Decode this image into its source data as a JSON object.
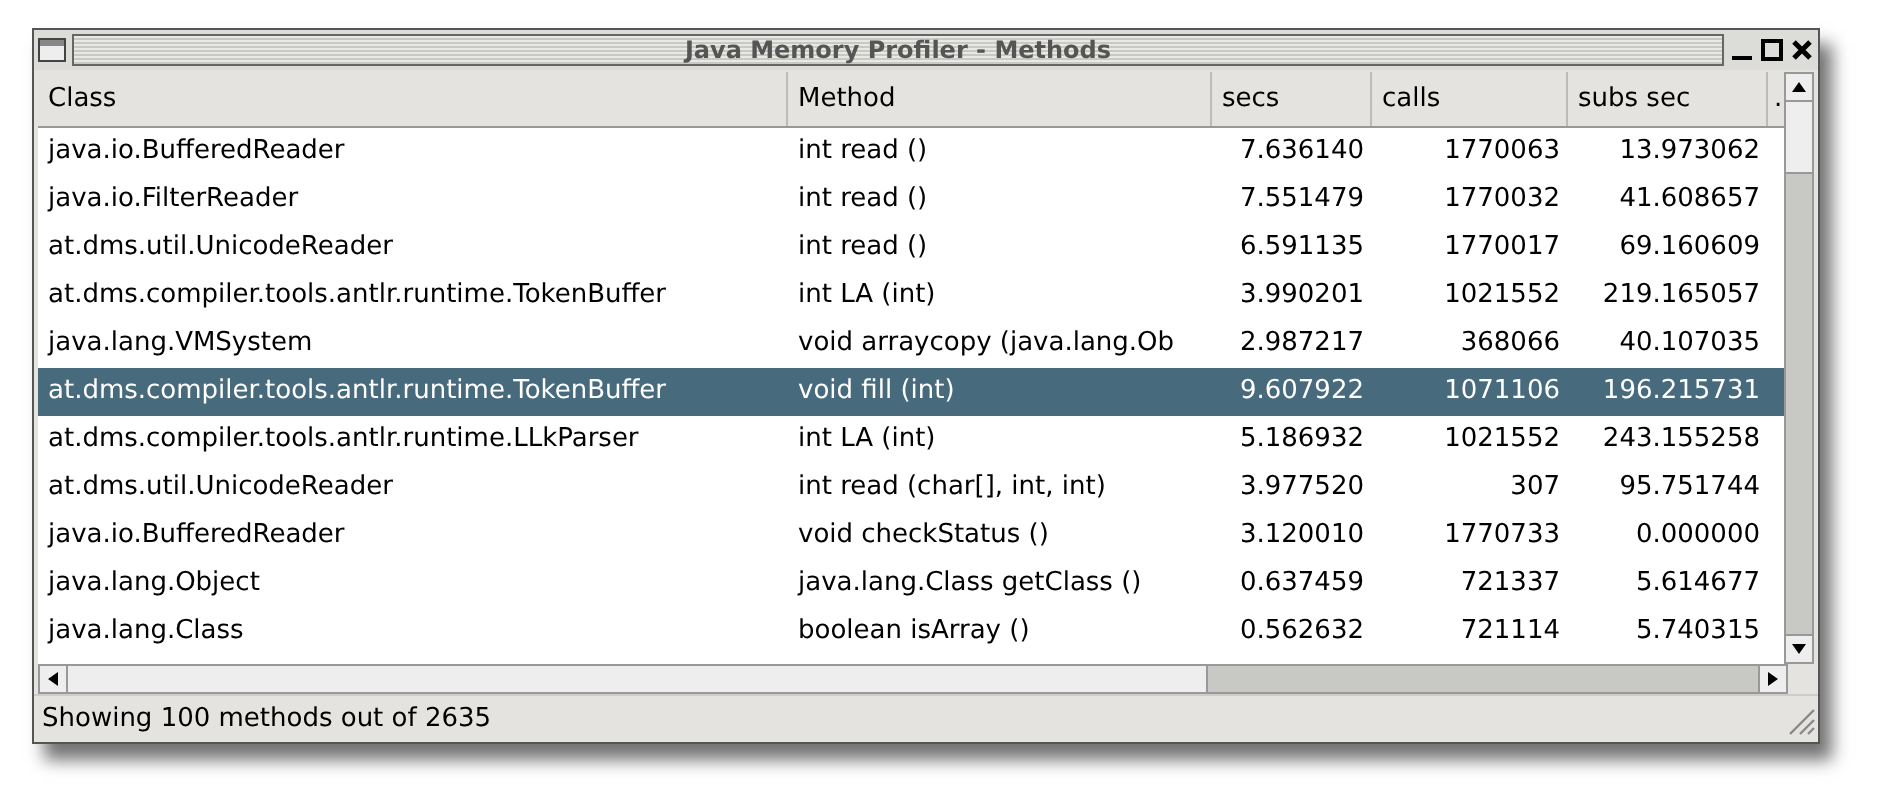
{
  "window": {
    "title": "Java Memory Profiler - Methods"
  },
  "table": {
    "columns": [
      {
        "label": "Class"
      },
      {
        "label": "Method"
      },
      {
        "label": "secs"
      },
      {
        "label": "calls"
      },
      {
        "label": "subs sec"
      },
      {
        "label": "."
      }
    ],
    "rows": [
      {
        "selected": false,
        "cells": [
          "java.io.BufferedReader",
          "int read ()",
          "7.636140",
          "1770063",
          "13.973062"
        ]
      },
      {
        "selected": false,
        "cells": [
          "java.io.FilterReader",
          "int read ()",
          "7.551479",
          "1770032",
          "41.608657"
        ]
      },
      {
        "selected": false,
        "cells": [
          "at.dms.util.UnicodeReader",
          "int read ()",
          "6.591135",
          "1770017",
          "69.160609"
        ]
      },
      {
        "selected": false,
        "cells": [
          "at.dms.compiler.tools.antlr.runtime.TokenBuffer",
          "int LA (int)",
          "3.990201",
          "1021552",
          "219.165057"
        ]
      },
      {
        "selected": false,
        "cells": [
          "java.lang.VMSystem",
          "void arraycopy (java.lang.Ob",
          "2.987217",
          "368066",
          "40.107035"
        ]
      },
      {
        "selected": true,
        "cells": [
          "at.dms.compiler.tools.antlr.runtime.TokenBuffer",
          "void fill (int)",
          "9.607922",
          "1071106",
          "196.215731"
        ]
      },
      {
        "selected": false,
        "cells": [
          "at.dms.compiler.tools.antlr.runtime.LLkParser",
          "int LA (int)",
          "5.186932",
          "1021552",
          "243.155258"
        ]
      },
      {
        "selected": false,
        "cells": [
          "at.dms.util.UnicodeReader",
          "int read (char[], int, int)",
          "3.977520",
          "307",
          "95.751744"
        ]
      },
      {
        "selected": false,
        "cells": [
          "java.io.BufferedReader",
          "void checkStatus ()",
          "3.120010",
          "1770733",
          "0.000000"
        ]
      },
      {
        "selected": false,
        "cells": [
          "java.lang.Object",
          "java.lang.Class getClass ()",
          "0.637459",
          "721337",
          "5.614677"
        ]
      },
      {
        "selected": false,
        "cells": [
          "java.lang.Class",
          "boolean isArray ()",
          "0.562632",
          "721114",
          "5.740315"
        ]
      }
    ]
  },
  "status_bar": "Showing 100 methods out of 2635"
}
